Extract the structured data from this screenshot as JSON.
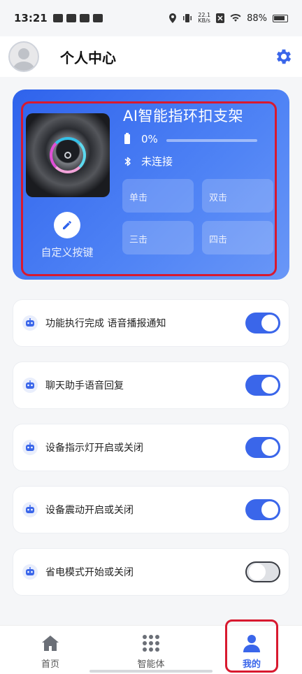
{
  "status_bar": {
    "time": "13:21",
    "net_speed": "22.1",
    "net_unit": "KB/s",
    "battery": "88%"
  },
  "header": {
    "title": "个人中心"
  },
  "device": {
    "name": "AI智能指环扣支架",
    "battery_percent": "0%",
    "battery_level": 0,
    "connection_status": "未连接",
    "custom_label": "自定义按键",
    "buttons": [
      "单击",
      "双击",
      "三击",
      "四击"
    ]
  },
  "settings": [
    {
      "label": "功能执行完成 语音播报通知",
      "enabled": true
    },
    {
      "label": "聊天助手语音回复",
      "enabled": true
    },
    {
      "label": "设备指示灯开启或关闭",
      "enabled": true
    },
    {
      "label": "设备震动开启或关闭",
      "enabled": true
    },
    {
      "label": "省电模式开始或关闭",
      "enabled": false
    }
  ],
  "nav": {
    "items": [
      "首页",
      "智能体",
      "我的"
    ],
    "active": "我的"
  },
  "colors": {
    "accent": "#3a66ea",
    "highlight": "#d8192f"
  }
}
